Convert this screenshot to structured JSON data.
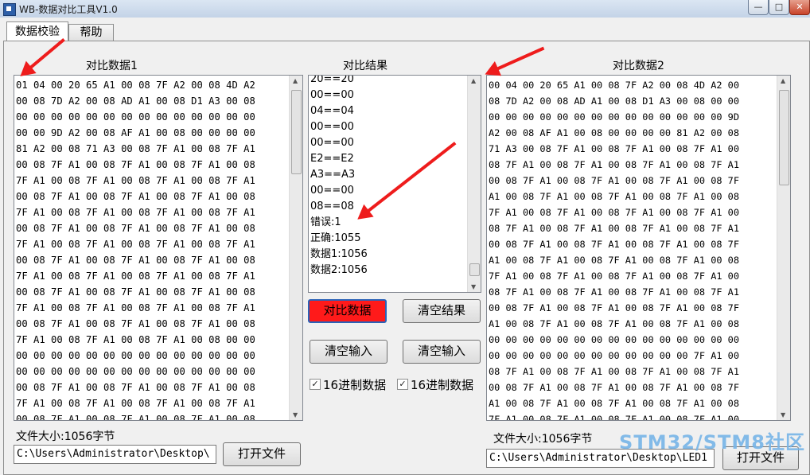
{
  "window": {
    "title": "WB-数据对比工具V1.0"
  },
  "tabs": [
    {
      "label": "数据校验"
    },
    {
      "label": "帮助"
    }
  ],
  "left": {
    "title": "对比数据1",
    "lines": [
      "01 04 00 20 65 A1 00 08 7F A2 00 08 4D A2",
      "00 08 7D A2 00 08 AD A1 00 08 D1 A3 00 08",
      "00 00 00 00 00 00 00 00 00 00 00 00 00 00",
      "00 00 9D A2 00 08 AF A1 00 08 00 00 00 00",
      "81 A2 00 08 71 A3 00 08 7F A1 00 08 7F A1",
      "00 08 7F A1 00 08 7F A1 00 08 7F A1 00 08",
      "7F A1 00 08 7F A1 00 08 7F A1 00 08 7F A1",
      "00 08 7F A1 00 08 7F A1 00 08 7F A1 00 08",
      "7F A1 00 08 7F A1 00 08 7F A1 00 08 7F A1",
      "00 08 7F A1 00 08 7F A1 00 08 7F A1 00 08",
      "7F A1 00 08 7F A1 00 08 7F A1 00 08 7F A1",
      "00 08 7F A1 00 08 7F A1 00 08 7F A1 00 08",
      "7F A1 00 08 7F A1 00 08 7F A1 00 08 7F A1",
      "00 08 7F A1 00 08 7F A1 00 08 7F A1 00 08",
      "7F A1 00 08 7F A1 00 08 7F A1 00 08 7F A1",
      "00 08 7F A1 00 08 7F A1 00 08 7F A1 00 08",
      "7F A1 00 08 7F A1 00 08 7F A1 00 08 00 00",
      "00 00 00 00 00 00 00 00 00 00 00 00 00 00",
      "00 00 00 00 00 00 00 00 00 00 00 00 00 00",
      "00 08 7F A1 00 08 7F A1 00 08 7F A1 00 08",
      "7F A1 00 08 7F A1 00 08 7F A1 00 08 7F A1",
      "00 08 7F A1 00 08 7F A1 00 08 7F A1 00 08"
    ],
    "file_size": "文件大小:1056字节",
    "path": "C:\\Users\\Administrator\\Desktop\\",
    "open_label": "打开文件"
  },
  "result": {
    "title": "对比结果",
    "lines": [
      "20==20",
      "00==00",
      "04==04",
      "00==00",
      "00==00",
      "E2==E2",
      "A3==A3",
      "00==00",
      "08==08",
      "错误:1",
      "正确:1055",
      "数据1:1056",
      "数据2:1056"
    ]
  },
  "buttons": {
    "compare": "对比数据",
    "clear_result": "清空结果",
    "clear_input_1": "清空输入",
    "clear_input_2": "清空输入"
  },
  "checkboxes": [
    {
      "label": "16进制数据",
      "checked": true,
      "mark": "✓"
    },
    {
      "label": "16进制数据",
      "checked": true,
      "mark": "✓"
    }
  ],
  "right": {
    "title": "对比数据2",
    "lines": [
      "00 04 00 20 65 A1 00 08 7F A2 00 08 4D A2 00",
      "08 7D A2 00 08 AD A1 00 08 D1 A3 00 08 00 00",
      "00 00 00 00 00 00 00 00 00 00 00 00 00 00 9D",
      "A2 00 08 AF A1 00 08 00 00 00 00 81 A2 00 08",
      "71 A3 00 08 7F A1 00 08 7F A1 00 08 7F A1 00",
      "08 7F A1 00 08 7F A1 00 08 7F A1 00 08 7F A1",
      "00 08 7F A1 00 08 7F A1 00 08 7F A1 00 08 7F",
      "A1 00 08 7F A1 00 08 7F A1 00 08 7F A1 00 08",
      "7F A1 00 08 7F A1 00 08 7F A1 00 08 7F A1 00",
      "08 7F A1 00 08 7F A1 00 08 7F A1 00 08 7F A1",
      "00 08 7F A1 00 08 7F A1 00 08 7F A1 00 08 7F",
      "A1 00 08 7F A1 00 08 7F A1 00 08 7F A1 00 08",
      "7F A1 00 08 7F A1 00 08 7F A1 00 08 7F A1 00",
      "08 7F A1 00 08 7F A1 00 08 7F A1 00 08 7F A1",
      "00 08 7F A1 00 08 7F A1 00 08 7F A1 00 08 7F",
      "A1 00 08 7F A1 00 08 7F A1 00 08 7F A1 00 08",
      "00 00 00 00 00 00 00 00 00 00 00 00 00 00 00",
      "00 00 00 00 00 00 00 00 00 00 00 00 7F A1 00",
      "08 7F A1 00 08 7F A1 00 08 7F A1 00 08 7F A1",
      "00 08 7F A1 00 08 7F A1 00 08 7F A1 00 08 7F",
      "A1 00 08 7F A1 00 08 7F A1 00 08 7F A1 00 08",
      "7F A1 00 08 7F A1 00 08 7F A1 00 08 7F A1 00"
    ],
    "file_size": "文件大小:1056字节",
    "path": "C:\\Users\\Administrator\\Desktop\\LED1",
    "open_label": "打开文件"
  },
  "window_controls": {
    "minimize": "—",
    "maximize": "□",
    "close": "✕"
  },
  "watermark": "STM32/STM8社区",
  "annotation_color": "#ee1c1c",
  "compare_button_color": "#ff1a1a"
}
